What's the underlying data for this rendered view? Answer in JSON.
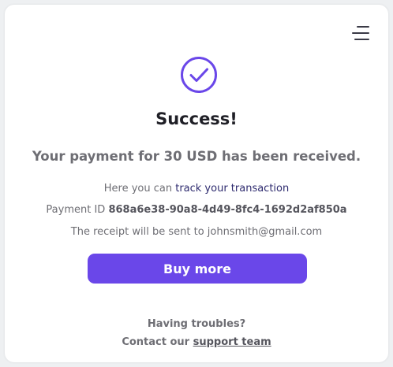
{
  "menu": {
    "icon": "hamburger-menu-icon"
  },
  "status": {
    "icon": "check-circle-icon",
    "accent_color": "#6a47e9",
    "title": "Success!"
  },
  "payment": {
    "message": "Your payment for 30 USD has been received.",
    "track_prefix": "Here you can ",
    "track_link": "track your transaction",
    "id_label": "Payment ID ",
    "id_value": "868a6e38-90a8-4d49-8fc4-1692d2af850a",
    "receipt": "The receipt will be sent to johnsmith@gmail.com"
  },
  "actions": {
    "buy_more": "Buy more"
  },
  "footer": {
    "troubles": "Having troubles?",
    "contact_prefix": "Contact our ",
    "support_link": "support team"
  }
}
